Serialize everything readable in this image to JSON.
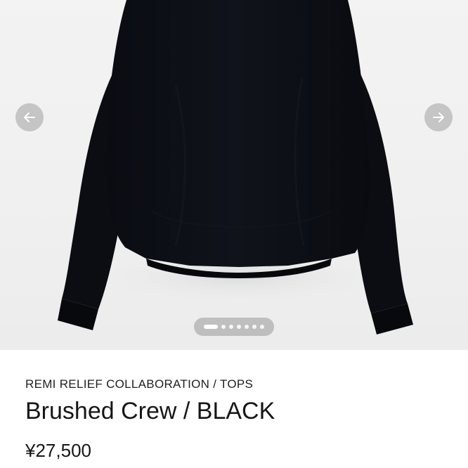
{
  "gallery": {
    "image_subject": "black sweatshirt",
    "prev_icon": "arrow-left-icon",
    "next_icon": "arrow-right-icon",
    "slide_count": 7,
    "active_slide": 1
  },
  "product": {
    "collection": "REMI RELIEF COLLABORATION / TOPS",
    "title": "Brushed Crew / BLACK",
    "price": "¥27,500"
  },
  "colors": {
    "garment": "#0c0e14",
    "background": "#f1f1f1",
    "arrow_bg": "#a0a0a0",
    "text": "#161616"
  }
}
